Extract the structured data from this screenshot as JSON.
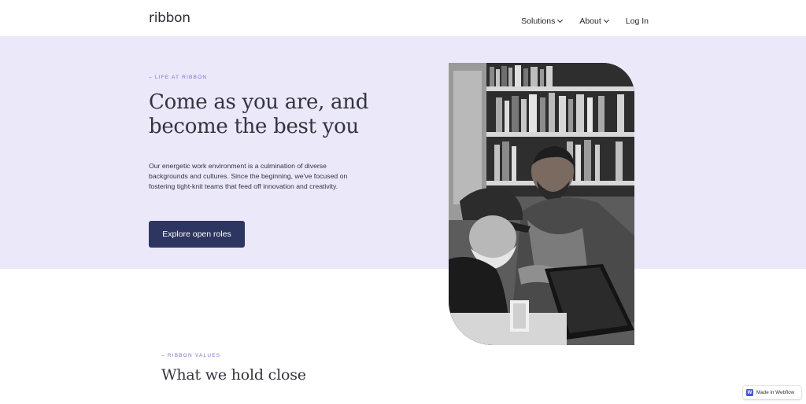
{
  "header": {
    "logo": "ribbon",
    "nav": [
      {
        "label": "Solutions",
        "has_dropdown": true
      },
      {
        "label": "About",
        "has_dropdown": true
      },
      {
        "label": "Log In",
        "has_dropdown": false
      }
    ]
  },
  "hero": {
    "eyebrow": "– LIFE AT RIBBON",
    "headline": "Come as you are, and become the best you",
    "intro": "Our energetic work environment is a culmination of diverse backgrounds and cultures. Since the beginning, we've focused on fostering tight-knit teams that feed off innovation and creativity.",
    "cta_label": "Explore open roles",
    "photo_icon": "team-photo"
  },
  "values": {
    "eyebrow": "– RIBBON VALUES",
    "title": "What we hold close"
  },
  "badge": {
    "icon_letter": "W",
    "label": "Made in Webflow"
  },
  "colors": {
    "hero_bg": "#eae8f9",
    "accent": "#7d6fd6",
    "button_bg": "#2d3561",
    "text": "#34343f",
    "webflow_blue": "#4353ff"
  }
}
